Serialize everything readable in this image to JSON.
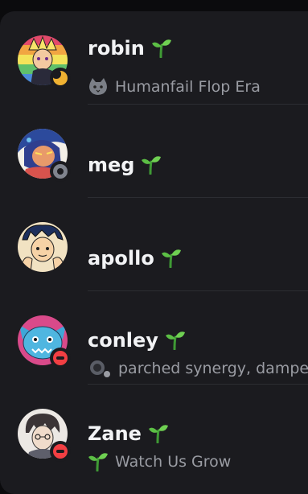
{
  "members": [
    {
      "name": "robin",
      "status": "idle",
      "activity": "Humanfail Flop Era",
      "activity_icon": "cat-emoji-icon"
    },
    {
      "name": "meg",
      "status": "offline",
      "activity": "",
      "activity_icon": ""
    },
    {
      "name": "apollo",
      "status": "none",
      "activity": "",
      "activity_icon": ""
    },
    {
      "name": "conley",
      "status": "dnd",
      "activity": "parched synergy, dampe",
      "activity_icon": "custom-emoji-icon"
    },
    {
      "name": "Zane",
      "status": "dnd",
      "activity": "Watch Us Grow",
      "activity_icon": "seedling-icon"
    }
  ],
  "colors": {
    "background": "#1b1b1f",
    "name": "#f2f3f5",
    "activity": "#9a9ca3",
    "idle": "#f0b232",
    "dnd": "#f23f43",
    "offline": "#80848e",
    "sprout": "#4cae3a"
  }
}
